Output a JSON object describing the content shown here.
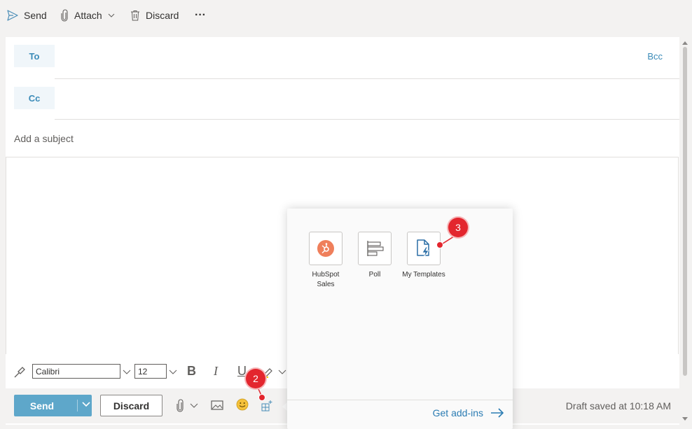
{
  "toolbar": {
    "send_label": "Send",
    "attach_label": "Attach",
    "discard_label": "Discard",
    "more_label": "···"
  },
  "recipients": {
    "to_label": "To",
    "cc_label": "Cc",
    "bcc_label": "Bcc"
  },
  "subject": {
    "placeholder": "Add a subject"
  },
  "format": {
    "font_family": "Calibri",
    "font_size": "12",
    "bold": "B",
    "italic": "I",
    "underline": "U"
  },
  "actions": {
    "send_label": "Send",
    "discard_label": "Discard",
    "draft_status": "Draft saved at 10:18 AM"
  },
  "addins_popup": {
    "items": [
      {
        "label_line1": "HubSpot",
        "label_line2": "Sales",
        "icon": "hubspot-icon"
      },
      {
        "label_line1": "Poll",
        "label_line2": "",
        "icon": "poll-icon"
      },
      {
        "label_line1": "My Templates",
        "label_line2": "",
        "icon": "my-templates-icon"
      }
    ],
    "get_addins_label": "Get add-ins"
  },
  "markers": {
    "step2": "2",
    "step3": "3"
  },
  "colors": {
    "accent": "#5ea7ca",
    "link": "#2b7cb3",
    "marker": "#e3262e",
    "hubspot": "#ef7f5b"
  }
}
